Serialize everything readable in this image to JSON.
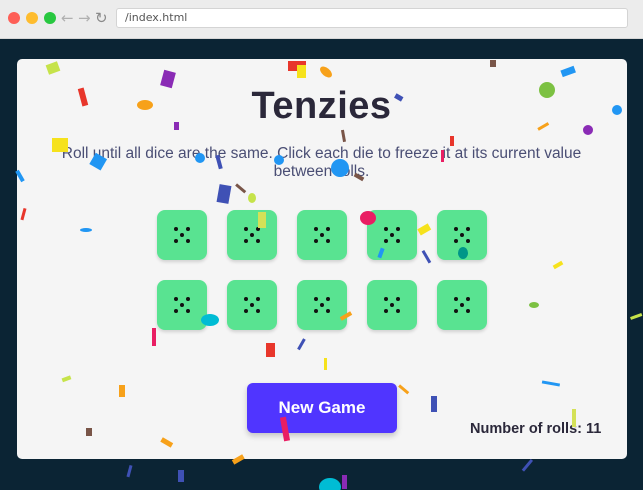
{
  "browser": {
    "url": "/index.html",
    "back_icon": "←",
    "forward_icon": "→",
    "reload_icon": "↻"
  },
  "game": {
    "title": "Tenzies",
    "instructions": "Roll until all dice are the same. Click each die to freeze it at its current value between rolls.",
    "dice": [
      {
        "value": 5,
        "held": false
      },
      {
        "value": 5,
        "held": false
      },
      {
        "value": 5,
        "held": false
      },
      {
        "value": 5,
        "held": false
      },
      {
        "value": 5,
        "held": false
      },
      {
        "value": 5,
        "held": false
      },
      {
        "value": 5,
        "held": false
      },
      {
        "value": 5,
        "held": false
      },
      {
        "value": 5,
        "held": false
      },
      {
        "value": 5,
        "held": false
      }
    ],
    "new_game_label": "New Game",
    "rolls_label": "Number of rolls: 11"
  },
  "colors": {
    "page_background": "#0b2434",
    "card_background": "#f5f5f5",
    "die_color": "#59e391",
    "button_color": "#5035ff",
    "title_color": "#2b283a"
  }
}
